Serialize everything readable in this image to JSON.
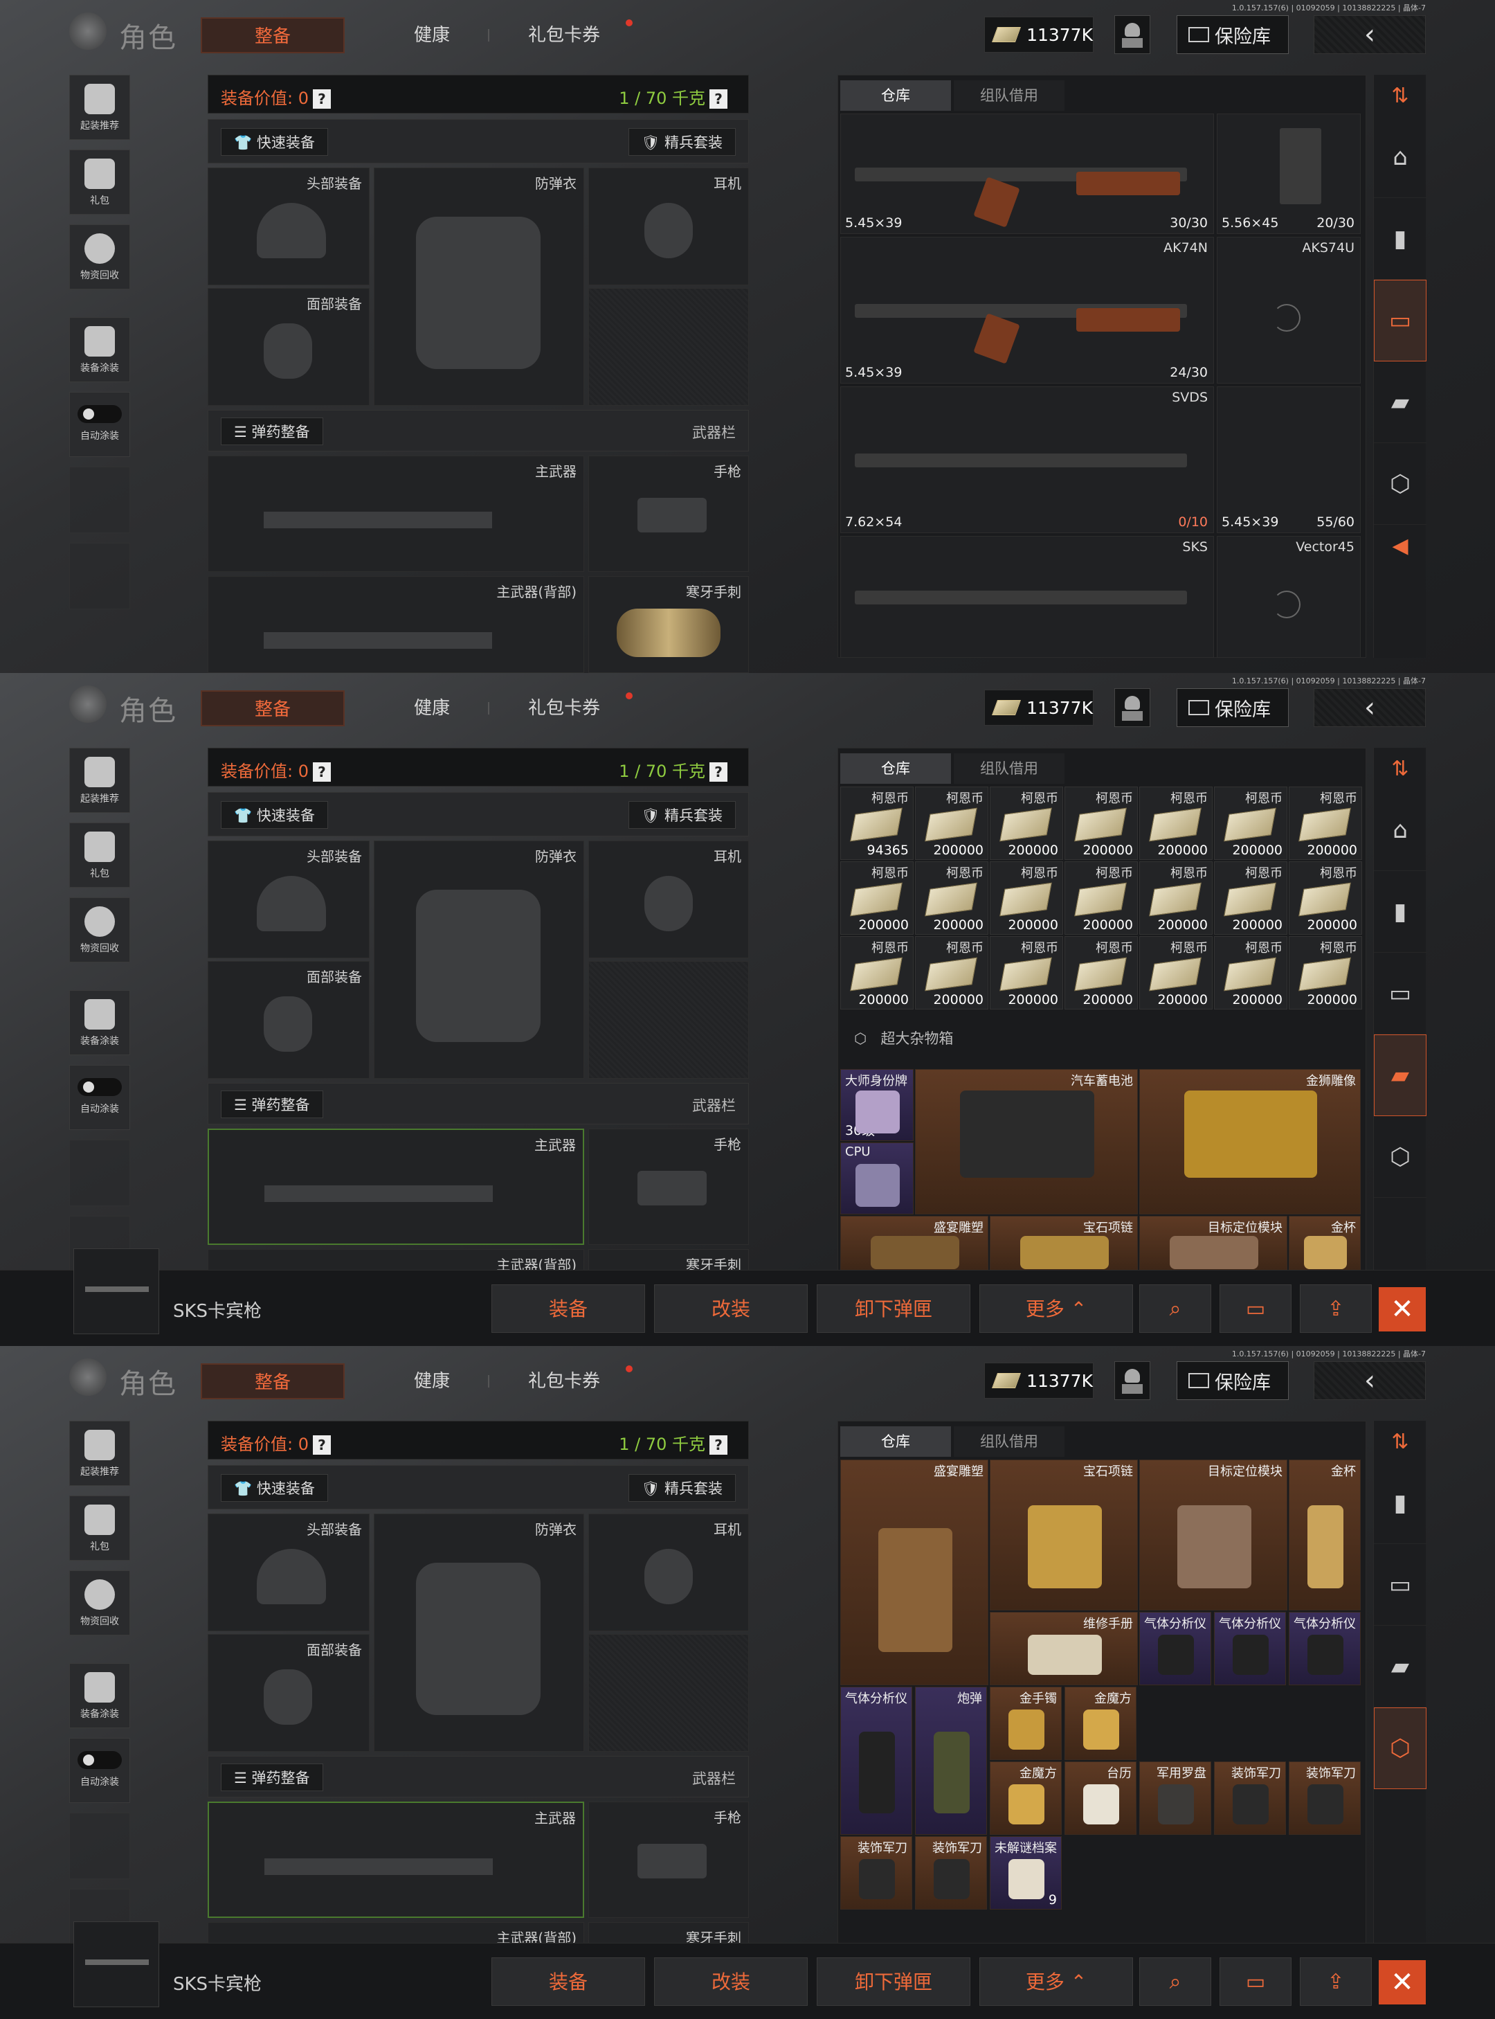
{
  "version": "1.0.157.157(6) | 01092059 | 10138822225 | 晶体-7",
  "header": {
    "title": "角色",
    "tabs": [
      "整备",
      "健康",
      "礼包卡券"
    ],
    "money": "11377K",
    "vault": "保险库"
  },
  "left_sidebar": [
    "起装推荐",
    "礼包",
    "物资回收",
    "装备涂装",
    "自动涂装"
  ],
  "equip": {
    "value_label": "装备价值: 0",
    "help": "?",
    "weight": "1 / 70 千克",
    "quick_equip": "快速装备",
    "elite_set": "精兵套装",
    "slots": {
      "head": "头部装备",
      "armor": "防弹衣",
      "ear": "耳机",
      "face": "面部装备",
      "primary": "主武器",
      "pistol": "手枪",
      "primary_back": "主武器(背部)",
      "knife": "寒牙手刺"
    },
    "ammo_btn": "弹药整备",
    "weapon_bar": "武器栏"
  },
  "warehouse": {
    "tabs": [
      "仓库",
      "组队借用"
    ],
    "guns": [
      {
        "name": "",
        "ammo": "5.45×39",
        "count": "30/30"
      },
      {
        "name": "",
        "ammo": "5.56×45",
        "count": "20/30"
      },
      {
        "name": "AK74N",
        "ammo": "5.45×39",
        "count": "24/30"
      },
      {
        "name": "AKS74U",
        "ammo": "",
        "count": ""
      },
      {
        "name": "SVDS",
        "ammo": "7.62×54",
        "count": "0/10"
      },
      {
        "name": "",
        "ammo": "5.45×39",
        "count": "55/60"
      },
      {
        "name": "SKS",
        "ammo": "",
        "count": ""
      },
      {
        "name": "Vector45",
        "ammo": "",
        "count": ""
      }
    ],
    "cash_name": "柯恩币",
    "cash_counts": [
      "94365",
      "200000",
      "200000",
      "200000",
      "200000",
      "200000",
      "200000",
      "200000",
      "200000",
      "200000",
      "200000",
      "200000",
      "200000",
      "200000",
      "200000",
      "200000",
      "200000",
      "200000",
      "200000",
      "200000",
      "200000"
    ],
    "crate_label": "超大杂物箱",
    "big_items_p2": [
      {
        "name": "大师身份牌",
        "count": "30级"
      },
      {
        "name": "CPU",
        "count": ""
      },
      {
        "name": "汽车蓄电池",
        "count": ""
      },
      {
        "name": "金狮雕像",
        "count": ""
      },
      {
        "name": "盛宴雕塑",
        "count": ""
      },
      {
        "name": "宝石项链",
        "count": ""
      },
      {
        "name": "目标定位模块",
        "count": ""
      },
      {
        "name": "金杯",
        "count": ""
      }
    ],
    "items_p3": [
      {
        "name": "盛宴雕塑",
        "count": ""
      },
      {
        "name": "宝石项链",
        "count": ""
      },
      {
        "name": "目标定位模块",
        "count": ""
      },
      {
        "name": "金杯",
        "count": ""
      },
      {
        "name": "维修手册",
        "count": ""
      },
      {
        "name": "气体分析仪",
        "count": ""
      },
      {
        "name": "气体分析仪",
        "count": ""
      },
      {
        "name": "气体分析仪",
        "count": ""
      },
      {
        "name": "气体分析仪",
        "count": ""
      },
      {
        "name": "炮弹",
        "count": ""
      },
      {
        "name": "金手镯",
        "count": ""
      },
      {
        "name": "金魔方",
        "count": ""
      },
      {
        "name": "金魔方",
        "count": ""
      },
      {
        "name": "台历",
        "count": ""
      },
      {
        "name": "军用罗盘",
        "count": ""
      },
      {
        "name": "装饰军刀",
        "count": ""
      },
      {
        "name": "装饰军刀",
        "count": ""
      },
      {
        "name": "装饰军刀",
        "count": ""
      },
      {
        "name": "装饰军刀",
        "count": ""
      },
      {
        "name": "未解谜档案",
        "count": "9"
      }
    ]
  },
  "action_bar": {
    "selected": "SKS卡宾枪",
    "buttons": [
      "装备",
      "改装",
      "卸下弹匣",
      "更多"
    ],
    "icons": [
      "search-icon",
      "unload-icon",
      "sell-icon",
      "close-icon"
    ]
  },
  "colors": {
    "accent": "#ee6a3a",
    "weight_green": "#8fcc40",
    "legendary_brown": "#5e3a24",
    "epic_purple": "#3a2f5a"
  }
}
